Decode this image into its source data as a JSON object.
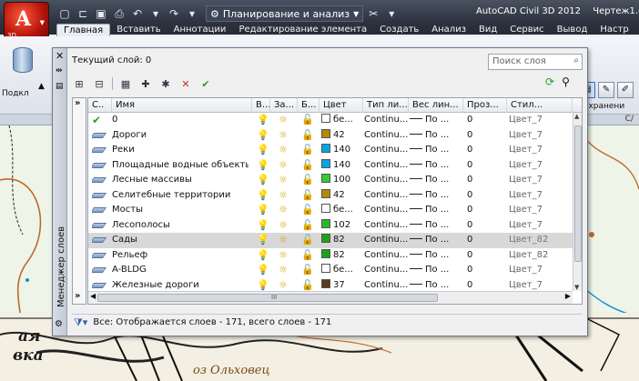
{
  "app": {
    "logo_letter": "A",
    "logo_tag": "3D",
    "title": "AutoCAD Civil 3D 2012",
    "document": "Чертеж1.dw"
  },
  "quick_access": {
    "workspace": "Планирование и анализ"
  },
  "ribbon_tabs": [
    "Главная",
    "Вставить",
    "Аннотации",
    "Редактирование элемента",
    "Создать",
    "Анализ",
    "Вид",
    "Сервис",
    "Вывод",
    "Настр"
  ],
  "ribbon": {
    "left_label": "Подкл",
    "saved_text": "сохранени",
    "panel_title": "С/"
  },
  "palette": {
    "vertical_title": "Менеджер слоев",
    "current_layer": "Текущий слой: 0",
    "search_placeholder": "Поиск слоя",
    "columns": [
      "С..",
      "Имя",
      "В...",
      "За...",
      "Б...",
      "Цвет",
      "Тип ли...",
      "Вес лин...",
      "Проз...",
      "Стил..."
    ],
    "layers": [
      {
        "current": true,
        "name": "0",
        "color_name": "бе...",
        "color": "#ffffff",
        "linetype": "Continu...",
        "lineweight": "По ...",
        "transparency": "0",
        "plot_style": "Цвет_7"
      },
      {
        "current": false,
        "name": "Дороги",
        "color_name": "42",
        "color": "#b38a00",
        "linetype": "Continu...",
        "lineweight": "По ...",
        "transparency": "0",
        "plot_style": "Цвет_7"
      },
      {
        "current": false,
        "name": "Реки",
        "color_name": "140",
        "color": "#00a6e6",
        "linetype": "Continu...",
        "lineweight": "По ...",
        "transparency": "0",
        "plot_style": "Цвет_7"
      },
      {
        "current": false,
        "name": "Площадные водные объекты",
        "color_name": "140",
        "color": "#00a6e6",
        "linetype": "Continu...",
        "lineweight": "По ...",
        "transparency": "0",
        "plot_style": "Цвет_7"
      },
      {
        "current": false,
        "name": "Лесные массивы",
        "color_name": "100",
        "color": "#33cc33",
        "linetype": "Continu...",
        "lineweight": "По ...",
        "transparency": "0",
        "plot_style": "Цвет_7"
      },
      {
        "current": false,
        "name": "Селитебные территории",
        "color_name": "42",
        "color": "#b38a00",
        "linetype": "Continu...",
        "lineweight": "По ...",
        "transparency": "0",
        "plot_style": "Цвет_7"
      },
      {
        "current": false,
        "name": "Мосты",
        "color_name": "бе...",
        "color": "#ffffff",
        "linetype": "Continu...",
        "lineweight": "По ...",
        "transparency": "0",
        "plot_style": "Цвет_7"
      },
      {
        "current": false,
        "name": "Лесополосы",
        "color_name": "102",
        "color": "#29b829",
        "linetype": "Continu...",
        "lineweight": "По ...",
        "transparency": "0",
        "plot_style": "Цвет_7"
      },
      {
        "current": false,
        "name": "Сады",
        "color_name": "82",
        "color": "#1aa31a",
        "linetype": "Continu...",
        "lineweight": "По ...",
        "transparency": "0",
        "plot_style": "Цвет_82",
        "selected": true
      },
      {
        "current": false,
        "name": "Рельеф",
        "color_name": "82",
        "color": "#1aa31a",
        "linetype": "Continu...",
        "lineweight": "По ...",
        "transparency": "0",
        "plot_style": "Цвет_82"
      },
      {
        "current": false,
        "name": "A-BLDG",
        "color_name": "бе...",
        "color": "#ffffff",
        "linetype": "Continu...",
        "lineweight": "По ...",
        "transparency": "0",
        "plot_style": "Цвет_7"
      },
      {
        "current": false,
        "name": "Железные дороги",
        "color_name": "37",
        "color": "#5a3a1a",
        "linetype": "Continu...",
        "lineweight": "По ...",
        "transparency": "0",
        "plot_style": "Цвет_7"
      }
    ],
    "status_text": "Все: Отображается слоев - 171, всего слоев - 171",
    "hscroll_grip": "III"
  },
  "map": {
    "labels": [
      "ая",
      "вка",
      "оз Ольховец"
    ]
  }
}
